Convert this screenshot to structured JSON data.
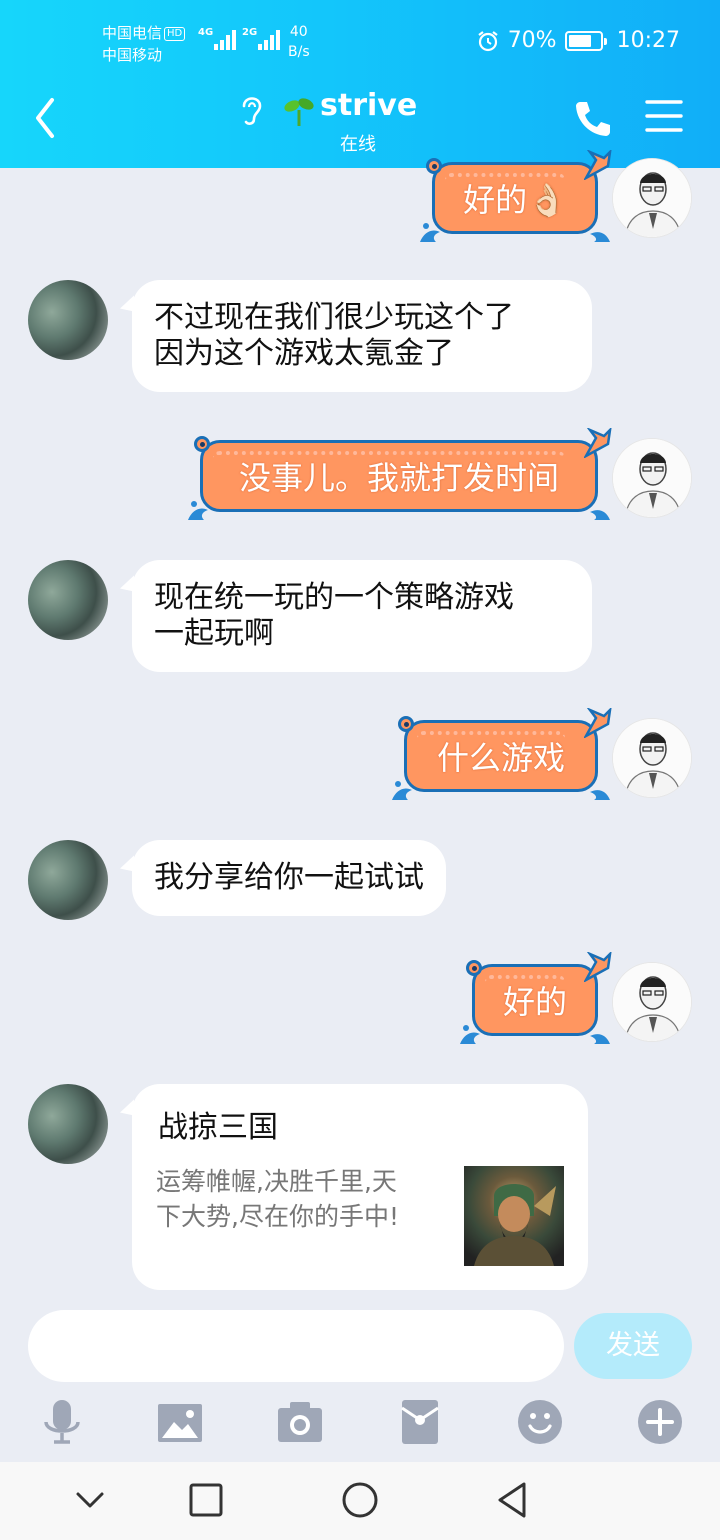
{
  "status_bar": {
    "carrier1": "中国电信",
    "hd": "HD",
    "carrier2": "中国移动",
    "sig1_label": "4G",
    "sig2_label": "2G",
    "speed_value": "40",
    "speed_unit": "B/s",
    "battery": "70%",
    "time": "10:27"
  },
  "header": {
    "name": "strive",
    "status": "在线"
  },
  "messages": [
    {
      "side": "right",
      "text": "好的👌🏻"
    },
    {
      "side": "left",
      "lines": [
        "不过现在我们很少玩这个了",
        "因为这个游戏太氪金了"
      ]
    },
    {
      "side": "right",
      "text": "没事儿。我就打发时间"
    },
    {
      "side": "left",
      "lines": [
        "现在统一玩的一个策略游戏",
        "一起玩啊"
      ]
    },
    {
      "side": "right",
      "text": "什么游戏"
    },
    {
      "side": "left",
      "lines": [
        "我分享给你一起试试"
      ]
    },
    {
      "side": "right",
      "text": "好的"
    }
  ],
  "share_card": {
    "title": "战掠三国",
    "desc_line1": "运筹帷幄,决胜千里,天",
    "desc_line2": "下大势,尽在你的手中!"
  },
  "input": {
    "send_label": "发送"
  },
  "icons": {
    "back": "back-arrow-icon",
    "ear": "ear-icon",
    "sprout": "sprout-icon",
    "phone": "phone-icon",
    "menu": "menu-icon",
    "tools": [
      "microphone-icon",
      "image-icon",
      "camera-icon",
      "red-packet-icon",
      "emoji-icon",
      "plus-icon"
    ]
  },
  "colors": {
    "header": "#13c6fb",
    "send_button": "#b4ebfb",
    "fish_bubble": "#ff9660",
    "background": "#eaedf4"
  }
}
